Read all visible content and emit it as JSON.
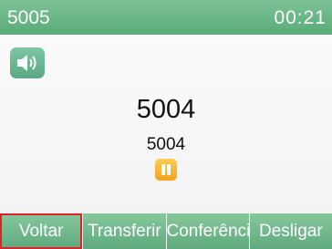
{
  "status": {
    "line": "5005",
    "timer": "00:21"
  },
  "call": {
    "name": "5004",
    "number": "5004",
    "speaker_icon": "speaker-icon",
    "hold_icon": "pause-icon"
  },
  "softkeys": [
    {
      "label": "Voltar",
      "selected": true
    },
    {
      "label": "Transferir"
    },
    {
      "label": "Conferência"
    },
    {
      "label": "Desligar"
    }
  ],
  "colors": {
    "accent_green": "#5aab7a",
    "hold_orange": "#f2a21c",
    "selection_red": "#e0202a"
  }
}
